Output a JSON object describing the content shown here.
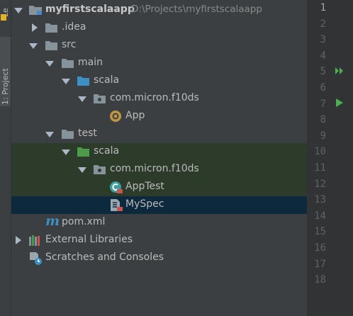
{
  "side": {
    "top_tab_label": "Le",
    "project_tab_label": "1: Project"
  },
  "tree": {
    "root": {
      "name": "myfirstscalaapp",
      "path": "D:\\Projects\\myfirstscalaapp"
    },
    "idea": ".idea",
    "src": "src",
    "main": "main",
    "main_scala": "scala",
    "main_pkg": "com.micron.f10ds",
    "app": "App",
    "test": "test",
    "test_scala": "scala",
    "test_pkg": "com.micron.f10ds",
    "apptest": "AppTest",
    "myspec": "MySpec",
    "pom": "pom.xml",
    "external": "External Libraries",
    "scratches": "Scratches and Consoles"
  },
  "gutter": {
    "line_numbers": [
      "1",
      "2",
      "3",
      "4",
      "5",
      "6",
      "7",
      "8",
      "9",
      "10",
      "11",
      "12",
      "13",
      "14",
      "15",
      "16",
      "17",
      "18"
    ],
    "current_line": "1"
  },
  "colors": {
    "selection": "#0d293e",
    "test_highlight": "#2d3b2a",
    "run_icon": "#4caf50"
  }
}
